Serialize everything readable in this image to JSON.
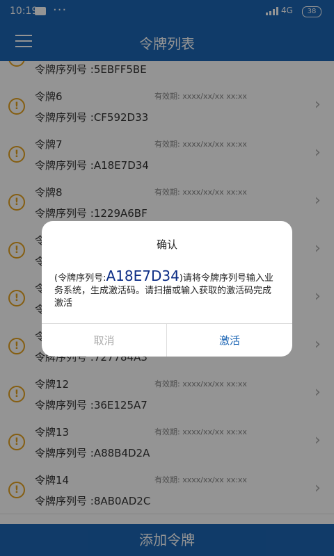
{
  "statusbar": {
    "time": "10:19",
    "more": "···",
    "network": "4G",
    "battery": "38"
  },
  "header": {
    "title": "令牌列表"
  },
  "tokens": [
    {
      "name": "",
      "expiry": "",
      "serial": "令牌序列号 :5EBFF5BE"
    },
    {
      "name": "令牌6",
      "expiry": "有效期: xxxx/xx/xx xx:xx",
      "serial": "令牌序列号 :CF592D33"
    },
    {
      "name": "令牌7",
      "expiry": "有效期: xxxx/xx/xx xx:xx",
      "serial": "令牌序列号 :A18E7D34"
    },
    {
      "name": "令牌8",
      "expiry": "有效期: xxxx/xx/xx xx:xx",
      "serial": "令牌序列号 :1229A6BF"
    },
    {
      "name": "令",
      "expiry": "",
      "serial": "令"
    },
    {
      "name": "令",
      "expiry": "",
      "serial": "令"
    },
    {
      "name": "令",
      "expiry": "",
      "serial": "令牌序列号 :727784A3"
    },
    {
      "name": "令牌12",
      "expiry": "有效期: xxxx/xx/xx xx:xx",
      "serial": "令牌序列号 :36E125A7"
    },
    {
      "name": "令牌13",
      "expiry": "有效期: xxxx/xx/xx xx:xx",
      "serial": "令牌序列号 :A88B4D2A"
    },
    {
      "name": "令牌14",
      "expiry": "有效期: xxxx/xx/xx xx:xx",
      "serial": "令牌序列号 :8AB0AD2C"
    }
  ],
  "add_button": "添加令牌",
  "dialog": {
    "title": "确认",
    "msg_prefix": "(令牌序列号:",
    "code": "A18E7D34",
    "msg_suffix": ")请将令牌序列号输入业务系统，生成激活码。请扫描或输入获取的激活码完成激活",
    "cancel": "取消",
    "activate": "激活"
  },
  "colors": {
    "primary": "#1d66b5",
    "warning": "#e6a21e",
    "code": "#0d2e86"
  }
}
